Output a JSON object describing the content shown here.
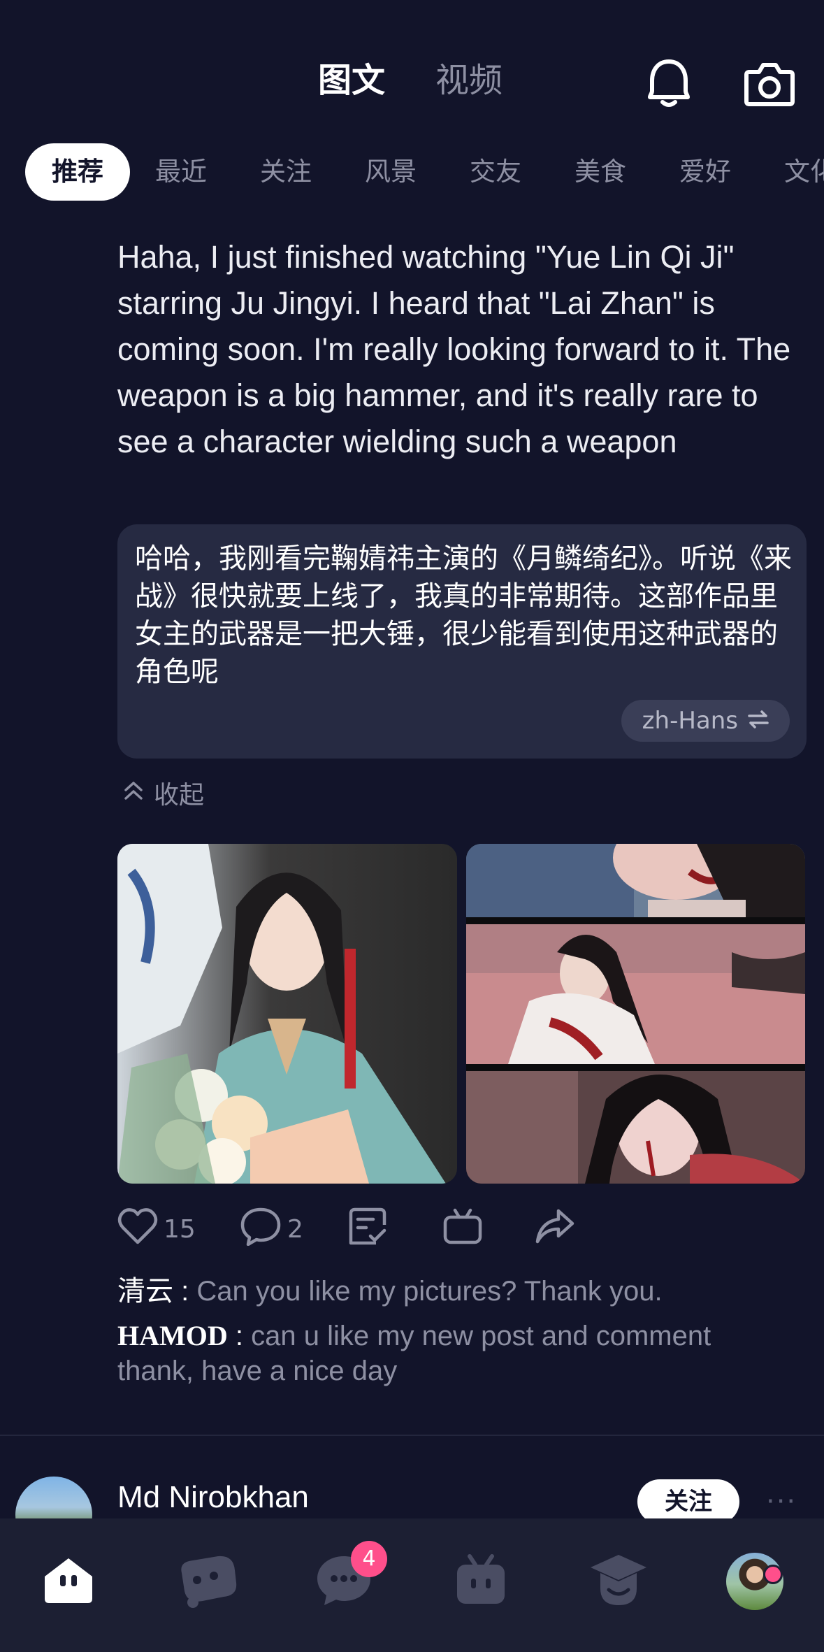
{
  "header": {
    "tabs": [
      {
        "label": "图文",
        "active": true
      },
      {
        "label": "视频",
        "active": false
      }
    ],
    "icons": [
      "bell-icon",
      "camera-icon"
    ]
  },
  "categories": [
    "推荐",
    "最近",
    "关注",
    "风景",
    "交友",
    "美食",
    "爱好",
    "文化"
  ],
  "post": {
    "text": "Haha, I just finished watching \"Yue Lin Qi Ji\" starring Ju Jingyi. I heard that \"Lai Zhan\" is coming soon. I'm really looking forward to it. The weapon is a big hammer, and it's really rare to see a character wielding such a weapon",
    "translation": "哈哈，我刚看完鞠婧祎主演的《月鳞绮纪》。听说《来战》很快就要上线了，我真的非常期待。这部作品里女主的武器是一把大锤，很少能看到使用这种武器的角色呢",
    "translation_lang": "zh-Hans",
    "collapse_label": "收起",
    "likes": "15",
    "comments_count": "2"
  },
  "comments": [
    {
      "author": "清云",
      "separator": " : ",
      "text": "Can you like my pictures? Thank you."
    },
    {
      "author": "HAMOD",
      "separator": " : ",
      "text": "can u like my new post and comment thank, have a nice day"
    }
  ],
  "next_post": {
    "author": "Md Nirobkhan",
    "follow_label": "关注",
    "more": "···"
  },
  "bottom_nav": {
    "items": [
      "home-icon",
      "game-controller-icon",
      "chat-icon",
      "tv-icon",
      "graduation-cap-icon",
      "profile-avatar"
    ],
    "chat_badge": "4"
  },
  "colors": {
    "background": "#12142a",
    "translation_bg": "#262a42",
    "muted_text": "#8e90a3",
    "badge": "#ff4f8b",
    "nav_bg": "#1c1f33"
  }
}
